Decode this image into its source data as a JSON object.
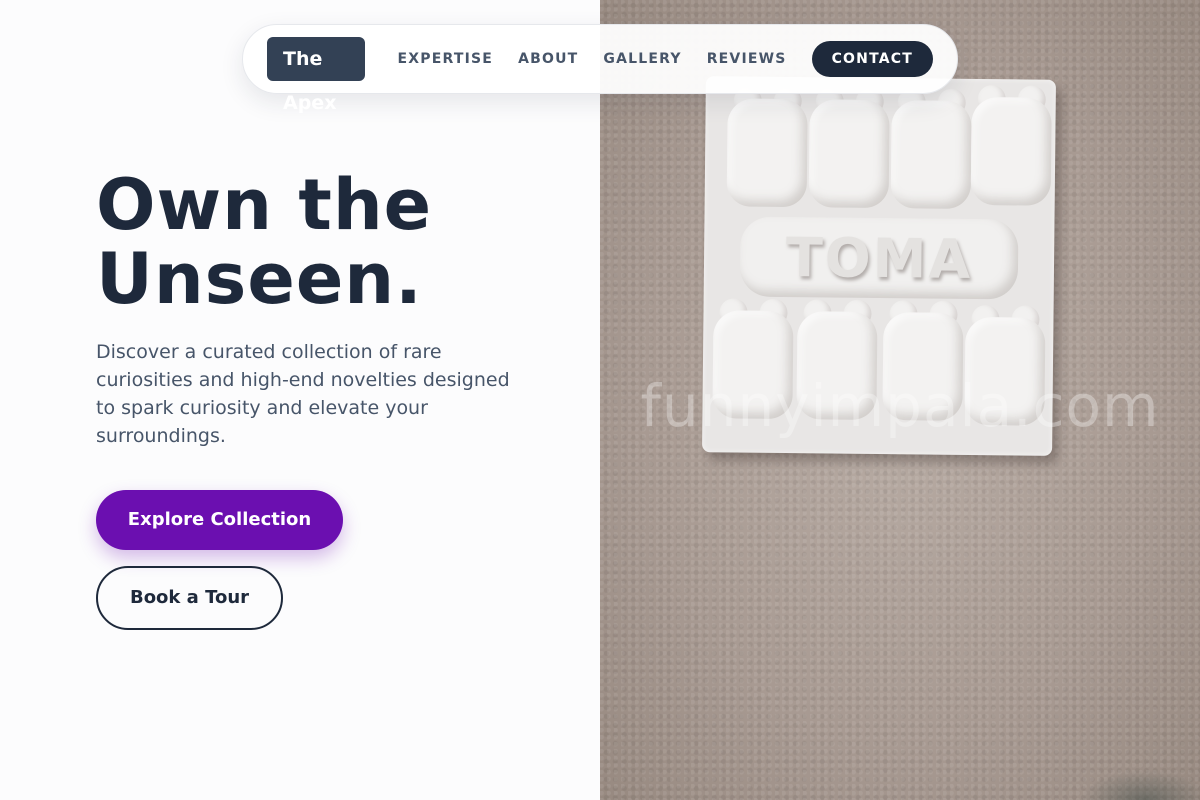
{
  "nav": {
    "logo": "The Apex",
    "links": [
      "EXPERTISE",
      "ABOUT",
      "GALLERY",
      "REVIEWS"
    ],
    "contact": "CONTACT"
  },
  "hero": {
    "title_line1": "Own the",
    "title_line2": "Unseen.",
    "description": "Discover a curated collection of rare curiosities and high-end novelties designed to spark curiosity and elevate your surroundings.",
    "primary_button": "Explore Collection",
    "secondary_button": "Book a Tour"
  },
  "image": {
    "plaque_text": "TOMA",
    "watermark": "funnyimpala.com"
  },
  "colors": {
    "primary": "#6b0fb0",
    "dark": "#1e293b",
    "slate": "#334155",
    "text_muted": "#475569"
  }
}
